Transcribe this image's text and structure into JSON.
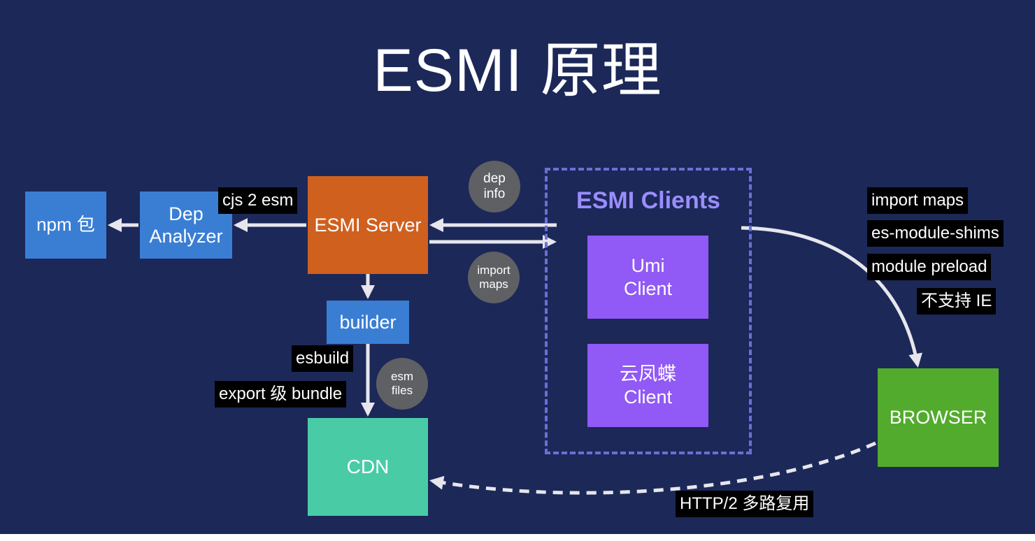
{
  "title": "ESMI 原理",
  "nodes": {
    "npm": "npm 包",
    "dep_analyzer": [
      "Dep",
      "Analyzer"
    ],
    "esmi_server": "ESMI Server",
    "builder": "builder",
    "cdn": "CDN",
    "clients_group": "ESMI Clients",
    "umi_client": [
      "Umi",
      "Client"
    ],
    "yunfengdie_client": [
      "云凤蝶",
      "Client"
    ],
    "browser": "BROWSER"
  },
  "labels": {
    "cjs2esm": "cjs 2 esm",
    "esbuild": "esbuild",
    "export_bundle": "export 级 bundle",
    "import_maps": "import maps",
    "es_module_shims": "es-module-shims",
    "module_preload": "module preload",
    "no_ie": "不支持 IE",
    "http2": "HTTP/2 多路复用"
  },
  "bubbles": {
    "dep_info": [
      "dep",
      "info"
    ],
    "import_maps": [
      "import",
      "maps"
    ],
    "esm_files": [
      "esm",
      "files"
    ]
  },
  "colors": {
    "background": "#1c2858",
    "blue": "#3a7ed4",
    "orange": "#d0601e",
    "teal": "#49cca6",
    "purple": "#9159f5",
    "green": "#52ab2c",
    "group_border": "#6a6fd6",
    "group_title": "#9a8dfb",
    "bubble": "#5e6063",
    "arrow": "#e6e6ec"
  }
}
